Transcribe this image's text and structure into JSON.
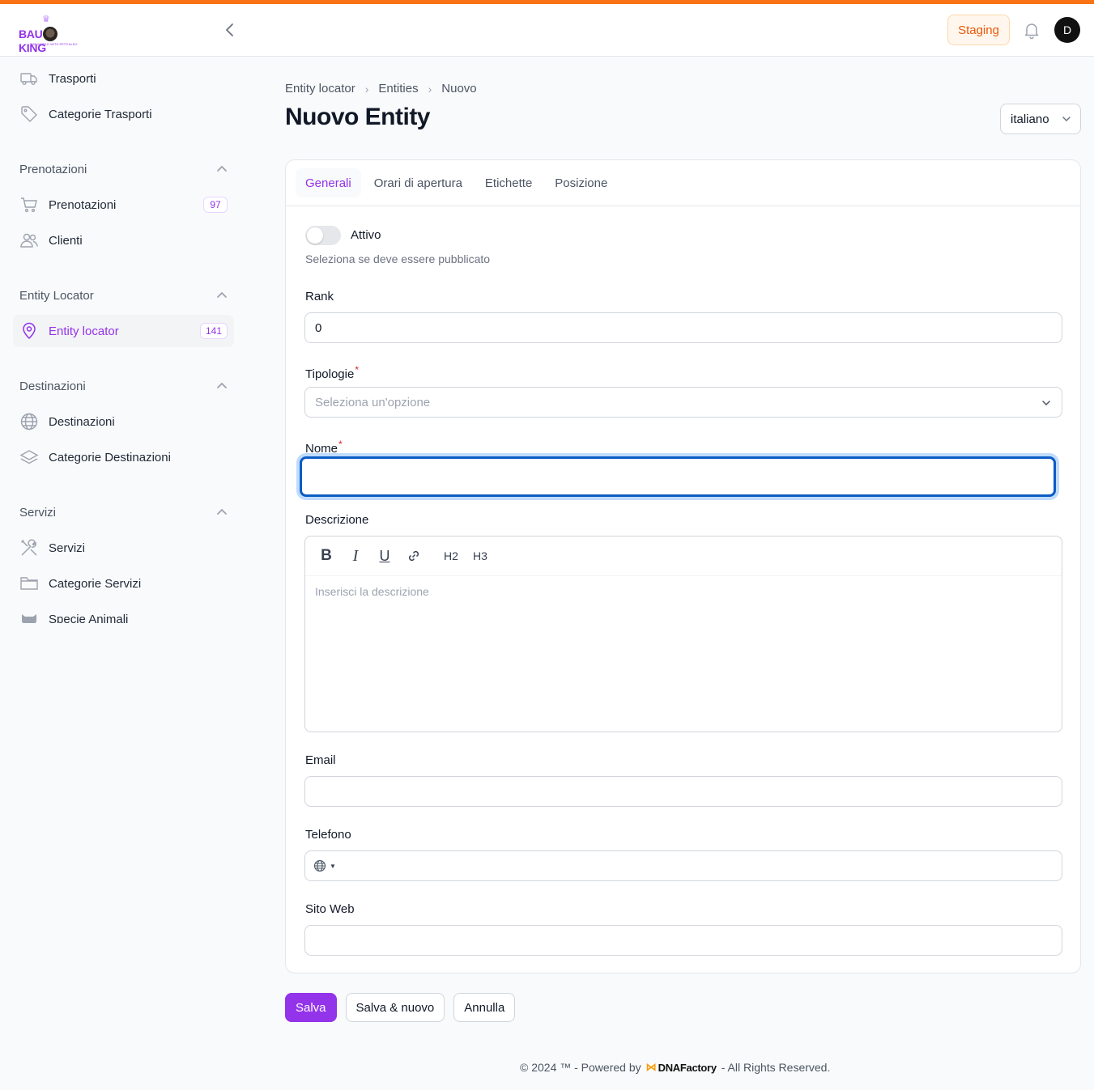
{
  "brand": {
    "logo_text_left": "BAU",
    "logo_text_right": "KING",
    "logo_tagline": "THE WORLD WITH PETS ALSO",
    "accent": "#9333ea",
    "stripe": "#f97316"
  },
  "topbar": {
    "environment_badge": "Staging",
    "avatar_initial": "D"
  },
  "sidebar": {
    "items_top": [
      {
        "label": "Trasporti",
        "icon": "truck-icon"
      },
      {
        "label": "Categorie Trasporti",
        "icon": "tag-icon"
      }
    ],
    "groups": [
      {
        "title": "Prenotazioni",
        "items": [
          {
            "label": "Prenotazioni",
            "icon": "cart-icon",
            "badge": "97"
          },
          {
            "label": "Clienti",
            "icon": "users-icon"
          }
        ]
      },
      {
        "title": "Entity Locator",
        "items": [
          {
            "label": "Entity locator",
            "icon": "map-pin-icon",
            "badge": "141",
            "active": true
          }
        ]
      },
      {
        "title": "Destinazioni",
        "items": [
          {
            "label": "Destinazioni",
            "icon": "globe-icon"
          },
          {
            "label": "Categorie Destinazioni",
            "icon": "layers-icon"
          }
        ]
      },
      {
        "title": "Servizi",
        "items": [
          {
            "label": "Servizi",
            "icon": "tools-icon"
          },
          {
            "label": "Categorie Servizi",
            "icon": "folder-icon"
          },
          {
            "label": "Specie Animali",
            "icon": "animal-icon"
          }
        ]
      }
    ]
  },
  "breadcrumb": [
    "Entity locator",
    "Entities",
    "Nuovo"
  ],
  "page": {
    "title": "Nuovo Entity",
    "language": "italiano"
  },
  "tabs": [
    "Generali",
    "Orari di apertura",
    "Etichette",
    "Posizione"
  ],
  "form": {
    "toggle_label": "Attivo",
    "toggle_on": false,
    "toggle_hint": "Seleziona se deve essere pubblicato",
    "rank_label": "Rank",
    "rank_value": "0",
    "tipologie_label": "Tipologie",
    "tipologie_placeholder": "Seleziona un'opzione",
    "nome_label": "Nome",
    "nome_value": "",
    "descrizione_label": "Descrizione",
    "descrizione_placeholder": "Inserisci la descrizione",
    "toolbar": {
      "bold": "B",
      "italic": "I",
      "underline": "U",
      "h2": "H2",
      "h3": "H3"
    },
    "email_label": "Email",
    "email_value": "",
    "telefono_label": "Telefono",
    "telefono_value": "",
    "sito_label": "Sito Web",
    "sito_value": "",
    "required_mark": "*"
  },
  "actions": {
    "save": "Salva",
    "save_new": "Salva & nuovo",
    "cancel": "Annulla"
  },
  "footer": {
    "left": "© 2024 ™ - Powered by",
    "brand": "DNAFactory",
    "right": "- All Rights Reserved."
  }
}
